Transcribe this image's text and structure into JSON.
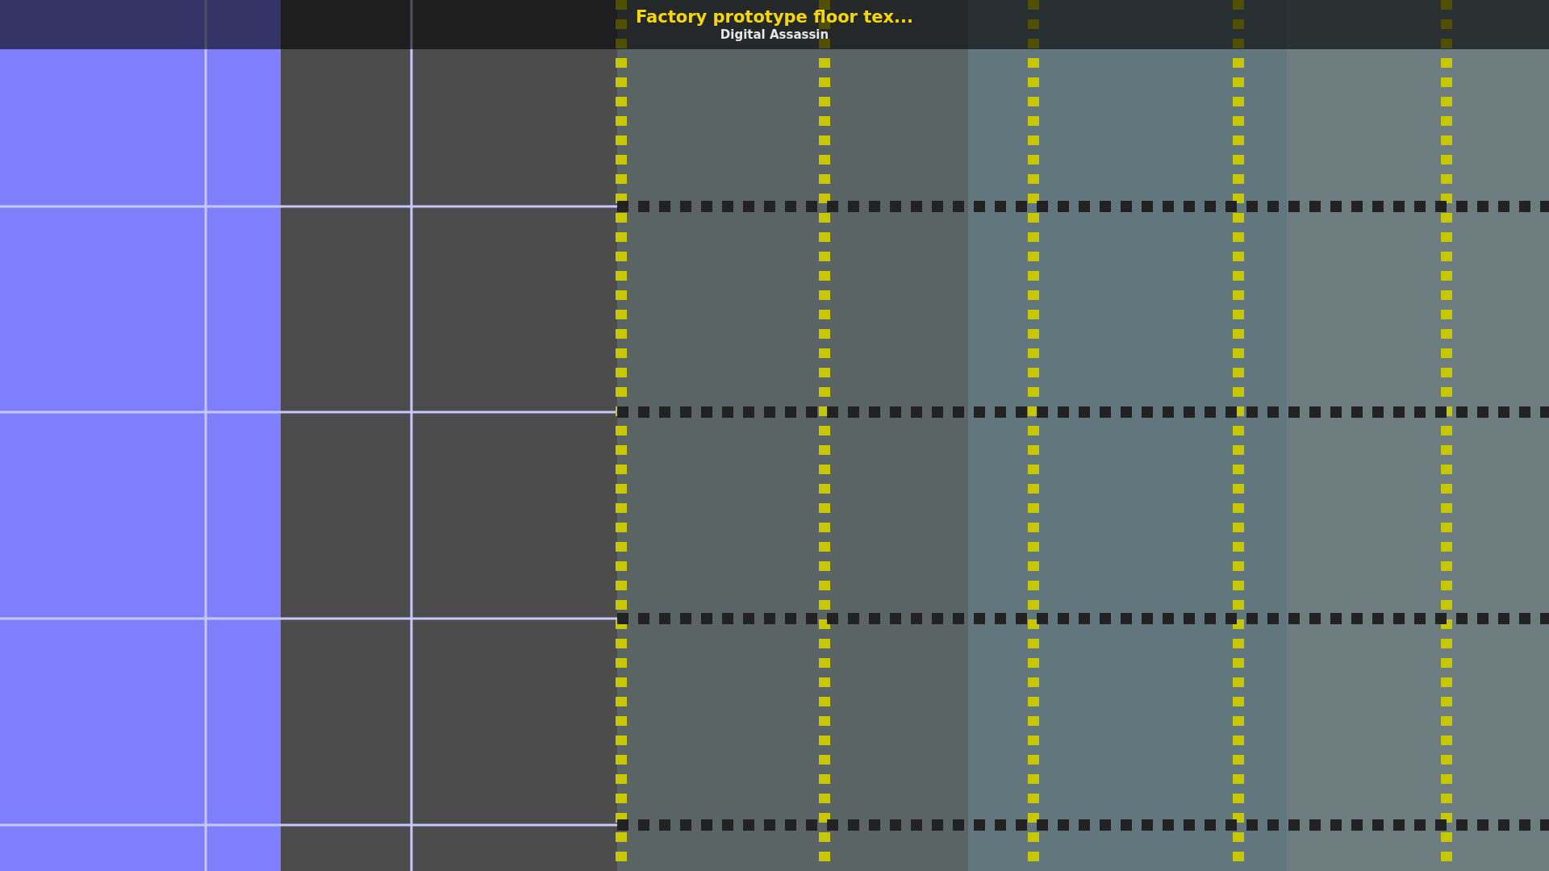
{
  "title": "Factory prototype floor tex...",
  "author": "Digital Assassin"
}
